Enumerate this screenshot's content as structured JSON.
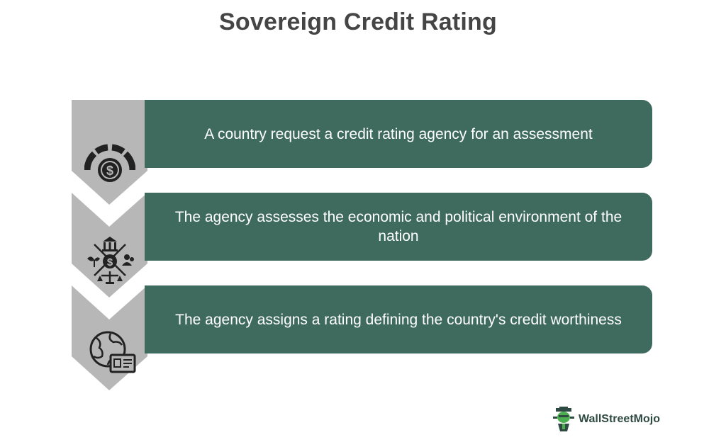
{
  "title": "Sovereign Credit Rating",
  "steps": [
    {
      "text": "A country request a credit rating agency for an assessment",
      "icon": "credit-score-gauge-icon"
    },
    {
      "text": "The agency assesses the economic and political environment of the nation",
      "icon": "economy-assessment-icon"
    },
    {
      "text": "The agency assigns a rating defining the country's credit worthiness",
      "icon": "globe-id-card-icon"
    }
  ],
  "logo": {
    "text": "WallStreetMojo",
    "icon": "mojo-mascot-icon"
  },
  "colors": {
    "box": "#3e6b5e",
    "chevron": "#b7b7b7",
    "title": "#454545",
    "icon": "#222222"
  }
}
